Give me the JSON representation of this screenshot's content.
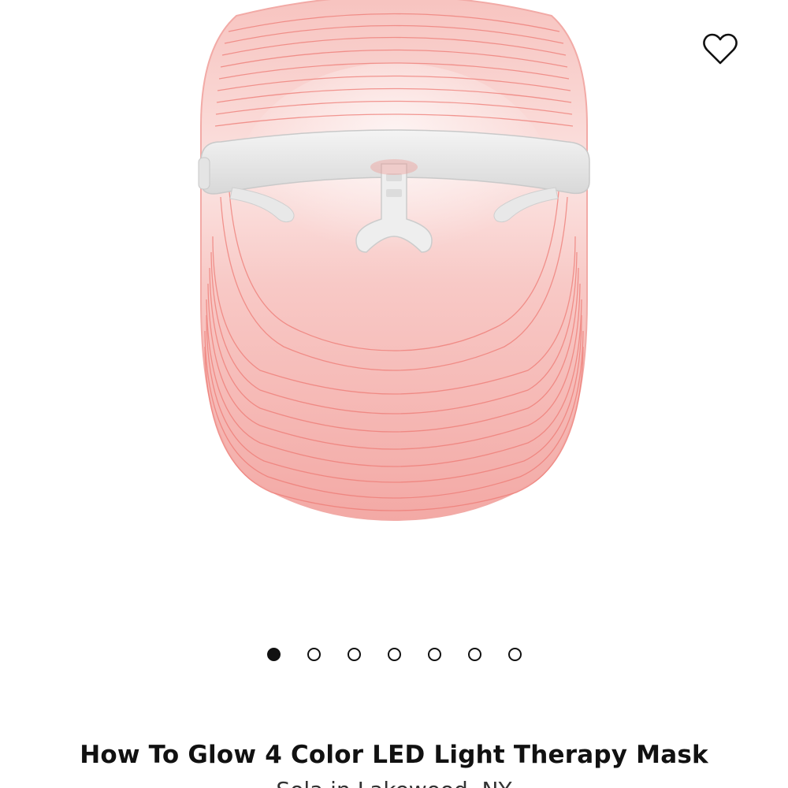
{
  "product": {
    "image_alt": "LED light therapy mask",
    "title": "How To Glow 4 Color LED Light Therapy Mask",
    "subtitle": "Sola in Lakewood, NY"
  },
  "favorite": {
    "icon": "heart-outline-icon"
  },
  "carousel": {
    "total": 7,
    "active_index": 0
  },
  "colors": {
    "mask_pink": "#f6b8b4",
    "mask_line": "#ee6e68",
    "strap": "#ececec",
    "text": "#111111"
  }
}
